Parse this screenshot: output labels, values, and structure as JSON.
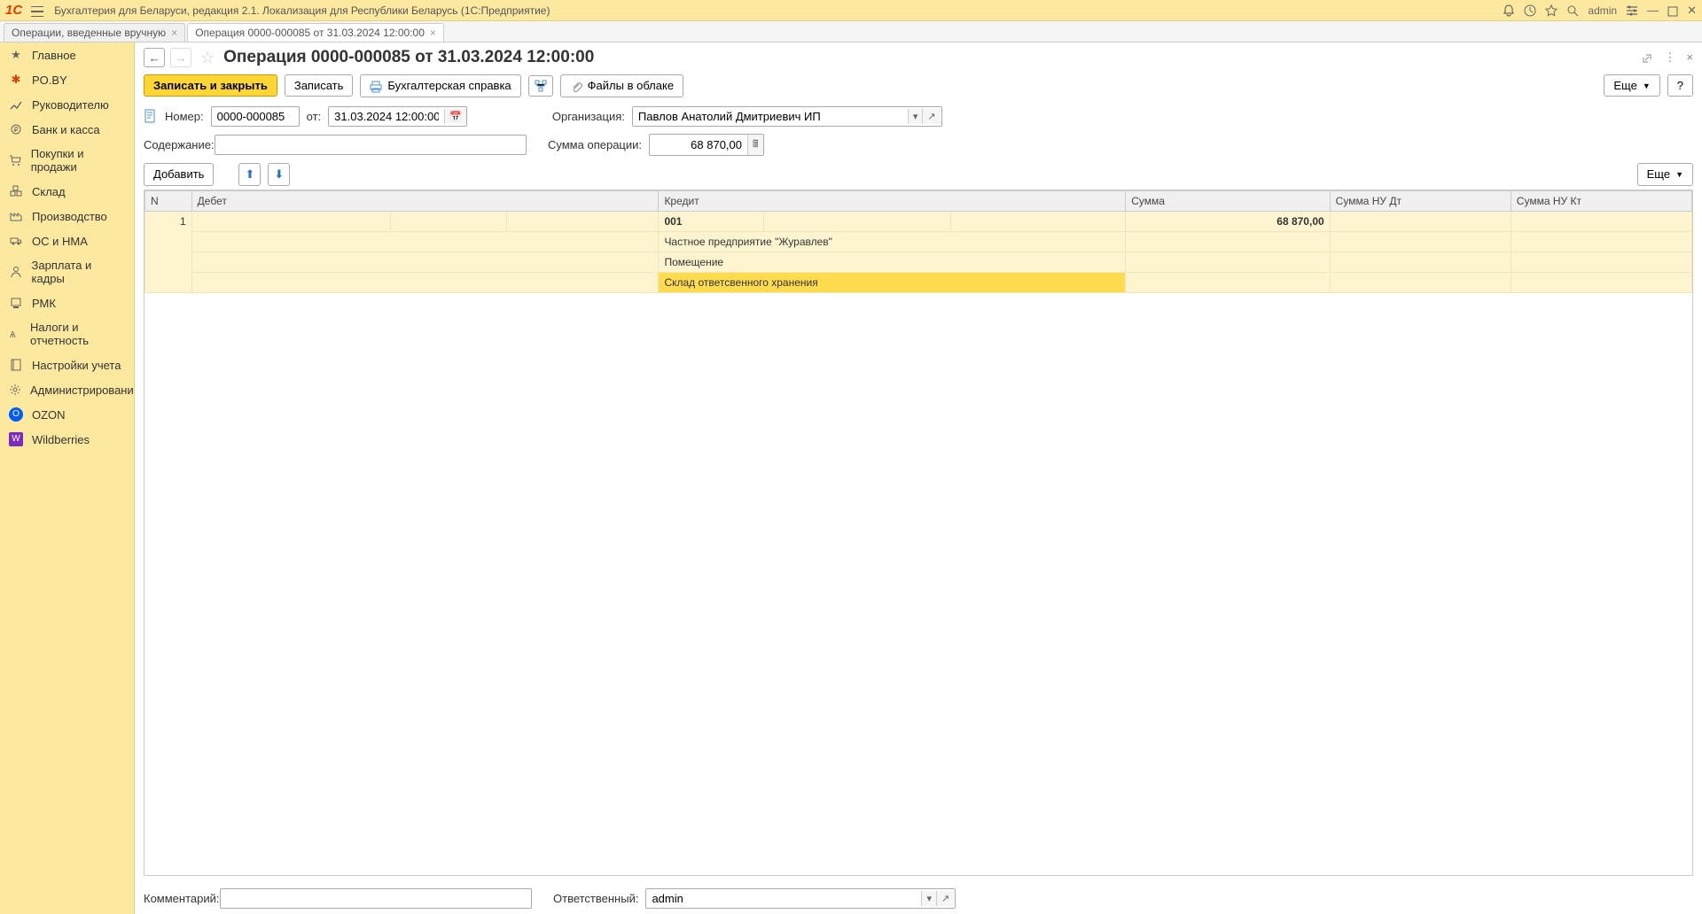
{
  "topbar": {
    "app_title": "Бухгалтерия для Беларуси, редакция 2.1. Локализация для Республики Беларусь   (1С:Предприятие)",
    "username": "admin"
  },
  "tabs": [
    {
      "label": "Операции, введенные вручную",
      "active": false
    },
    {
      "label": "Операция 0000-000085 от 31.03.2024 12:00:00",
      "active": true
    }
  ],
  "sidebar": {
    "items": [
      {
        "label": "Главное",
        "icon": "star"
      },
      {
        "label": "PO.BY",
        "icon": "poby"
      },
      {
        "label": "Руководителю",
        "icon": "chart"
      },
      {
        "label": "Банк и касса",
        "icon": "bank"
      },
      {
        "label": "Покупки и продажи",
        "icon": "cart"
      },
      {
        "label": "Склад",
        "icon": "boxes"
      },
      {
        "label": "Производство",
        "icon": "factory"
      },
      {
        "label": "ОС и НМА",
        "icon": "truck"
      },
      {
        "label": "Зарплата и кадры",
        "icon": "person"
      },
      {
        "label": "РМК",
        "icon": "pos"
      },
      {
        "label": "Налоги и отчетность",
        "icon": "tax"
      },
      {
        "label": "Настройки учета",
        "icon": "book"
      },
      {
        "label": "Администрирование",
        "icon": "gear"
      },
      {
        "label": "OZON",
        "icon": "ozon"
      },
      {
        "label": "Wildberries",
        "icon": "wb"
      }
    ]
  },
  "page": {
    "title": "Операция 0000-000085 от 31.03.2024 12:00:00"
  },
  "toolbar": {
    "save_close": "Записать и закрыть",
    "save": "Записать",
    "accounting_ref": "Бухгалтерская справка",
    "files": "Файлы в облаке",
    "more": "Еще",
    "help": "?"
  },
  "form": {
    "number_label": "Номер:",
    "number_value": "0000-000085",
    "from_label": "от:",
    "date_value": "31.03.2024 12:00:00",
    "org_label": "Организация:",
    "org_value": "Павлов Анатолий Дмитриевич ИП",
    "content_label": "Содержание:",
    "content_value": "",
    "sum_label": "Сумма операции:",
    "sum_value": "68 870,00",
    "add": "Добавить",
    "comment_label": "Комментарий:",
    "comment_value": "",
    "responsible_label": "Ответственный:",
    "responsible_value": "admin"
  },
  "table": {
    "headers": {
      "n": "N",
      "debit": "Дебет",
      "credit": "Кредит",
      "sum": "Сумма",
      "sum_nu_dt": "Сумма НУ Дт",
      "sum_nu_kt": "Сумма НУ Кт"
    },
    "row": {
      "n": "1",
      "credit_account": "001",
      "credit_sub1": "Частное предприятие \"Журавлев\"",
      "credit_sub2": "Помещение",
      "credit_sub3": "Склад ответсвенного хранения",
      "sum": "68 870,00"
    }
  }
}
